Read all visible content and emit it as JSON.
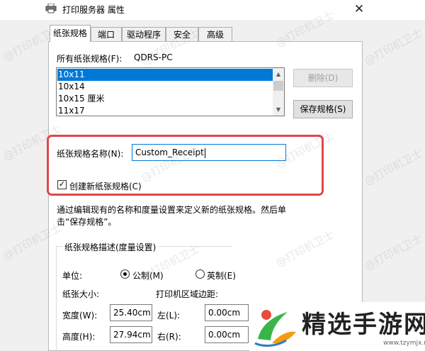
{
  "window": {
    "title": "打印服务器 属性",
    "close_glyph": "✕"
  },
  "tabs": [
    {
      "label": "纸张规格",
      "active": true
    },
    {
      "label": "端口"
    },
    {
      "label": "驱动程序"
    },
    {
      "label": "安全"
    },
    {
      "label": "高级"
    }
  ],
  "forms": {
    "all_label": "所有纸张规格(F):",
    "server_name": "QDRS-PC",
    "list_items": [
      "10x11",
      "10x14",
      "10x15 厘米",
      "11x17"
    ],
    "delete_button": "删除(D)",
    "save_button": "保存规格(S)",
    "name_label": "纸张规格名称(N):",
    "name_value": "Custom_Receipt",
    "create_checkbox": "创建新纸张规格(C)",
    "create_checked": true,
    "desc_line1": "通过编辑现有的名称和度量设置来定义新的纸张规格。然后单",
    "desc_line2": "击“保存规格”。"
  },
  "group": {
    "title": "纸张规格描述(度量设置)",
    "unit_label": "单位:",
    "metric": "公制(M)",
    "imperial": "英制(E)",
    "metric_selected": true,
    "paper_size_label": "纸张大小:",
    "margin_label": "打印机区域边距:",
    "width_label": "宽度(W):",
    "width_value": "25.40cm",
    "height_label": "高度(H):",
    "height_value": "27.94cm",
    "left_label": "左(L):",
    "left_value": "0.00cm",
    "right_label": "右(R):",
    "right_value": "0.00cm"
  },
  "watermark": "@打印机卫士",
  "logo": {
    "name": "精选手游网",
    "url": "www.tzymjx.net"
  },
  "colors": {
    "selection": "#0078d7",
    "highlight": "#e0474c",
    "logo_green": "#39b54a",
    "logo_orange": "#f39c12",
    "logo_red": "#e74c3c"
  }
}
